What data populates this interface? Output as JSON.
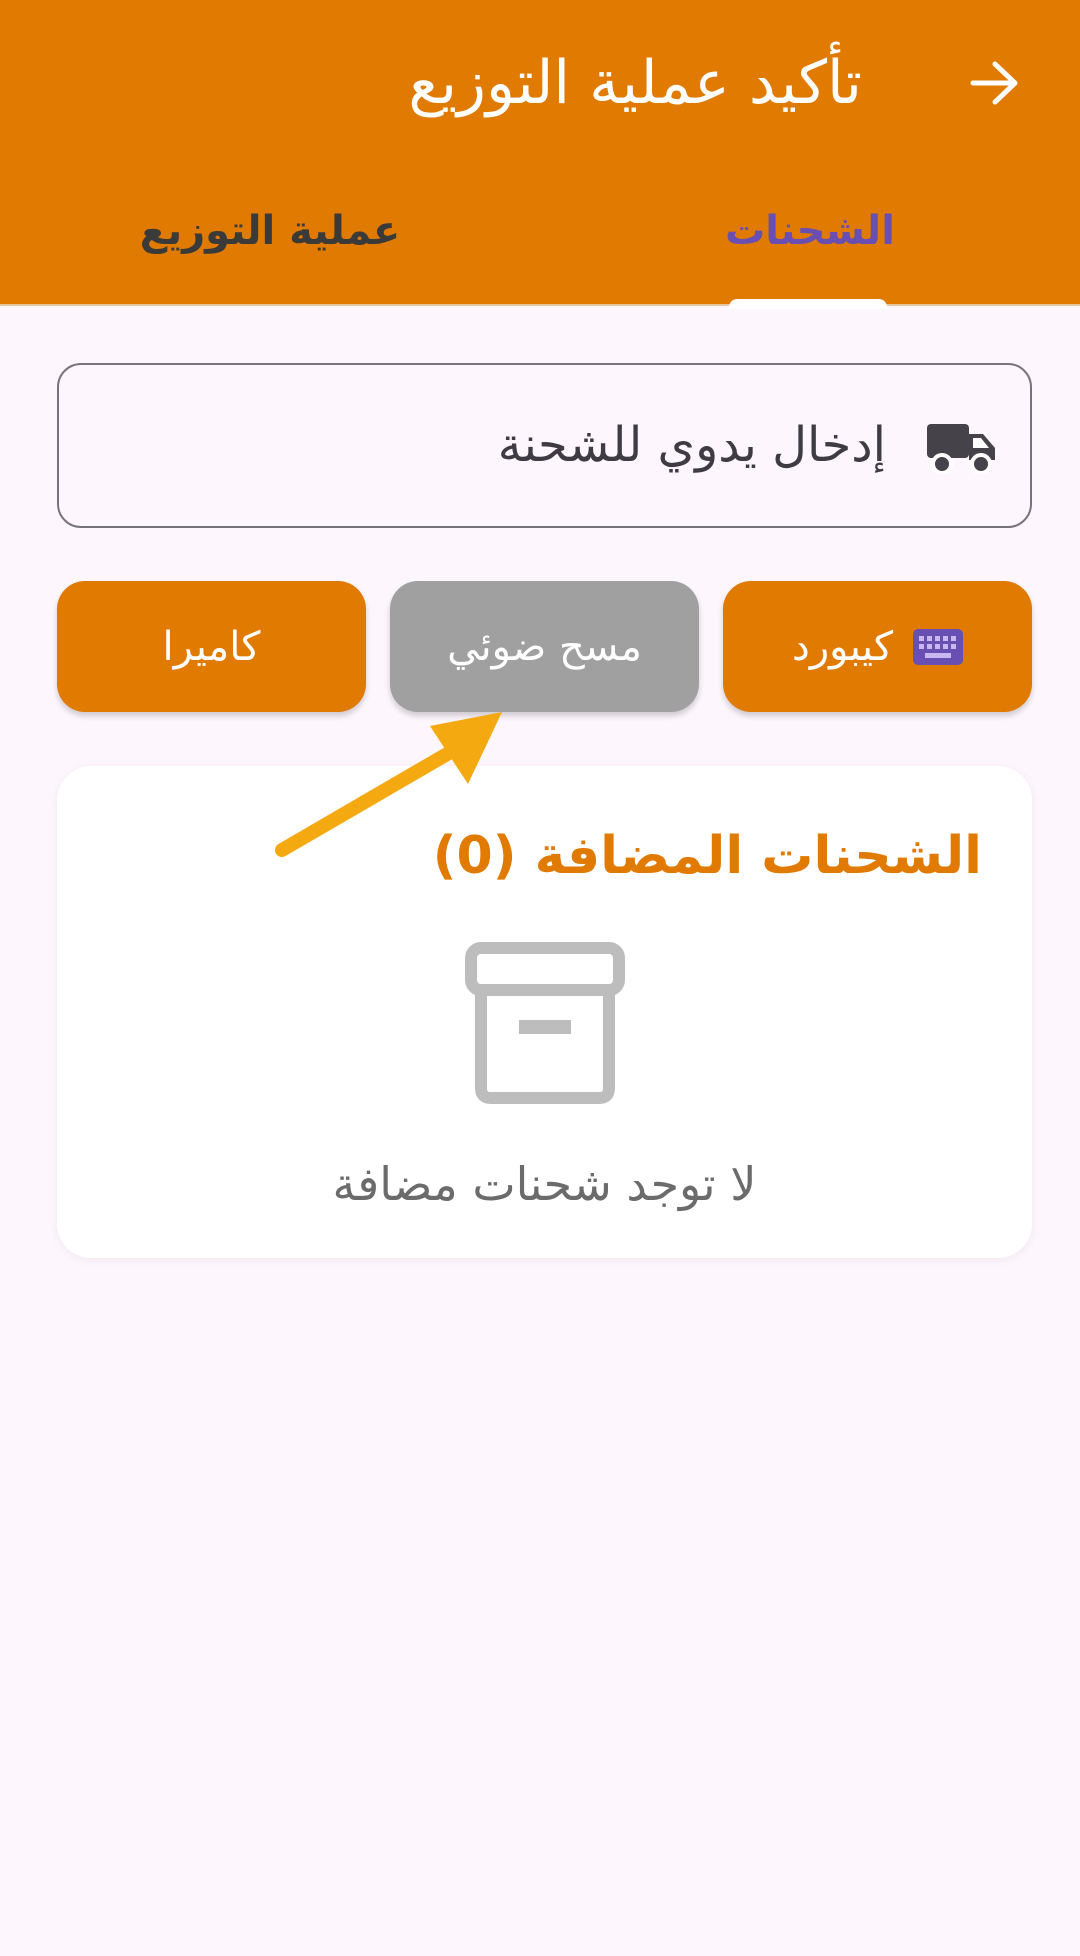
{
  "header": {
    "title": "تأكيد عملية التوزيع",
    "back_icon": "arrow-right-icon"
  },
  "tabs": [
    {
      "label": "الشحنات",
      "selected": true
    },
    {
      "label": "عملية التوزيع",
      "selected": false
    }
  ],
  "manual_entry": {
    "label": "إدخال يدوي للشحنة",
    "icon": "truck-icon"
  },
  "input_modes": {
    "keyboard": {
      "label": "كيبورد",
      "icon": "keyboard-icon"
    },
    "scan": {
      "label": "مسح ضوئي"
    },
    "camera": {
      "label": "كاميرا"
    }
  },
  "added_shipments": {
    "title": "الشحنات المضافة (0)",
    "empty_text": "لا توجد شحنات مضافة",
    "empty_icon": "archive-box-icon"
  },
  "colors": {
    "primary": "#E07A00",
    "accent_purple": "#6A4FB3",
    "disabled_gray": "#A0A0A0",
    "annotation_arrow": "#F5A910",
    "background": "#FDF7FD"
  }
}
